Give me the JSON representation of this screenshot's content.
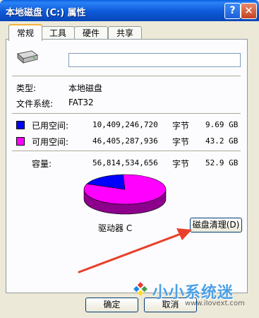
{
  "window": {
    "title": "本地磁盘 (C:) 属性",
    "help_glyph": "?",
    "close_glyph": "✕"
  },
  "tabs": [
    {
      "label": "常规",
      "active": true
    },
    {
      "label": "工具",
      "active": false
    },
    {
      "label": "硬件",
      "active": false
    },
    {
      "label": "共享",
      "active": false
    }
  ],
  "general": {
    "drive_icon": "hard-drive-icon",
    "name_value": "",
    "type_label": "类型:",
    "type_value": "本地磁盘",
    "fs_label": "文件系统:",
    "fs_value": "FAT32",
    "used": {
      "label": "已用空间:",
      "bytes": "10,409,246,720",
      "unit": "字节",
      "size": "9.69 GB",
      "color": "#0000ff"
    },
    "free": {
      "label": "可用空间:",
      "bytes": "46,405,287,936",
      "unit": "字节",
      "size": "43.2 GB",
      "color": "#ff00ff"
    },
    "capacity": {
      "label": "容量:",
      "bytes": "56,814,534,656",
      "unit": "字节",
      "size": "52.9 GB"
    },
    "drive_label": "驱动器 C",
    "cleanup_button": "磁盘清理(D)"
  },
  "chart_data": {
    "type": "pie",
    "slices": [
      {
        "name": "已用空间",
        "value": 9.69,
        "color": "#0000ff"
      },
      {
        "name": "可用空间",
        "value": 43.2,
        "color": "#ff00ff"
      }
    ]
  },
  "buttons": {
    "ok": "确定",
    "cancel": "取消"
  },
  "annotation": {
    "arrow_color": "#e8402a"
  },
  "watermark": {
    "logo_icon": "windows-flag-icon",
    "text": "小小系统迷",
    "url": "www.iIovext.com"
  }
}
